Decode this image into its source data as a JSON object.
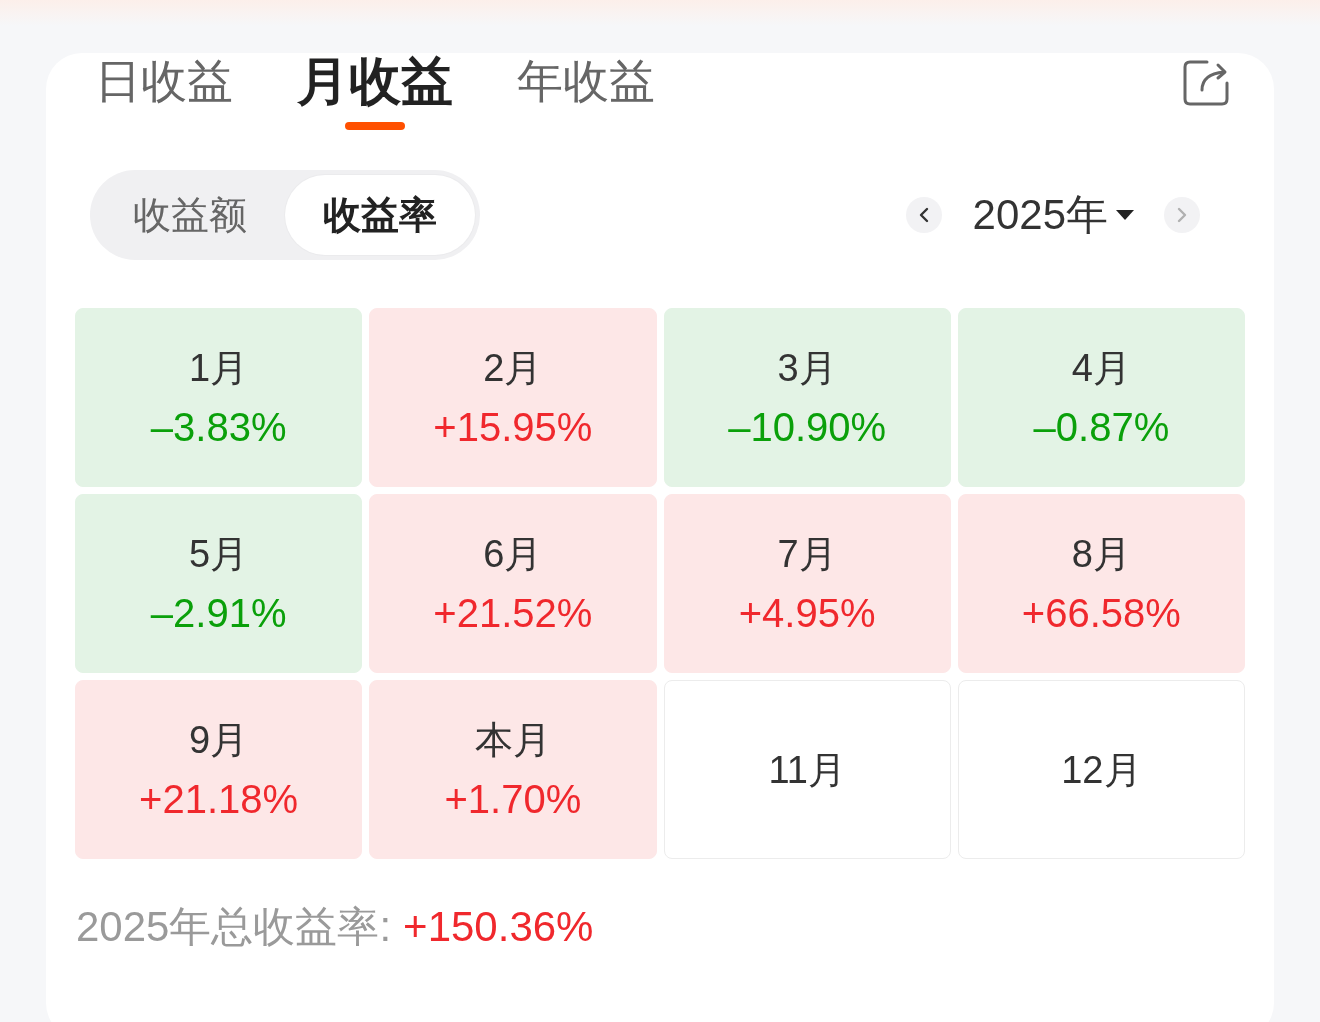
{
  "tabs": [
    {
      "label": "日收益",
      "selected": false
    },
    {
      "label": "月收益",
      "selected": true
    },
    {
      "label": "年收益",
      "selected": false
    }
  ],
  "metric_toggle": [
    {
      "label": "收益额",
      "selected": false
    },
    {
      "label": "收益率",
      "selected": true
    }
  ],
  "year_nav": {
    "prev": {
      "disabled": false
    },
    "year": "2025年",
    "next": {
      "disabled": true
    }
  },
  "months": [
    {
      "label": "1月",
      "value": "–3.83%",
      "kind": "loss"
    },
    {
      "label": "2月",
      "value": "+15.95%",
      "kind": "gain"
    },
    {
      "label": "3月",
      "value": "–10.90%",
      "kind": "loss"
    },
    {
      "label": "4月",
      "value": "–0.87%",
      "kind": "loss"
    },
    {
      "label": "5月",
      "value": "–2.91%",
      "kind": "loss"
    },
    {
      "label": "6月",
      "value": "+21.52%",
      "kind": "gain"
    },
    {
      "label": "7月",
      "value": "+4.95%",
      "kind": "gain"
    },
    {
      "label": "8月",
      "value": "+66.58%",
      "kind": "gain"
    },
    {
      "label": "9月",
      "value": "+21.18%",
      "kind": "gain"
    },
    {
      "label": "本月",
      "value": "+1.70%",
      "kind": "gain"
    },
    {
      "label": "11月",
      "kind": "future"
    },
    {
      "label": "12月",
      "kind": "future"
    }
  ],
  "summary": {
    "label": "2025年总收益率:",
    "value": "+150.36%",
    "kind": "gain"
  }
}
